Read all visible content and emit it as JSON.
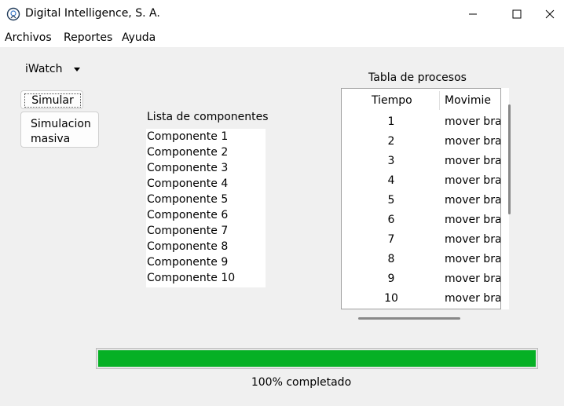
{
  "window": {
    "title": "Digital Intelligence, S. A."
  },
  "menu": [
    "Archivos",
    "Reportes",
    "Ayuda"
  ],
  "device_select": {
    "value": "iWatch"
  },
  "buttons": {
    "simular": "Simular",
    "masiva_line1": "Simulacion",
    "masiva_line2": "masiva"
  },
  "components": {
    "title": "Lista de componentes",
    "items": [
      "Componente 1",
      "Componente 2",
      "Componente 3",
      "Componente 4",
      "Componente 5",
      "Componente 6",
      "Componente 7",
      "Componente 8",
      "Componente 9",
      "Componente 10"
    ]
  },
  "process_table": {
    "title": "Tabla de procesos",
    "headers": [
      "Tiempo",
      "Movimie"
    ],
    "rows": [
      [
        "1",
        "mover braz"
      ],
      [
        "2",
        "mover braz"
      ],
      [
        "3",
        "mover braz"
      ],
      [
        "4",
        "mover braz"
      ],
      [
        "5",
        "mover braz"
      ],
      [
        "6",
        "mover braz"
      ],
      [
        "7",
        "mover braz"
      ],
      [
        "8",
        "mover braz"
      ],
      [
        "9",
        "mover braz"
      ],
      [
        "10",
        "mover braz"
      ]
    ]
  },
  "progress": {
    "fraction": 1.0,
    "label": "100% completado",
    "color": "#06b025"
  }
}
